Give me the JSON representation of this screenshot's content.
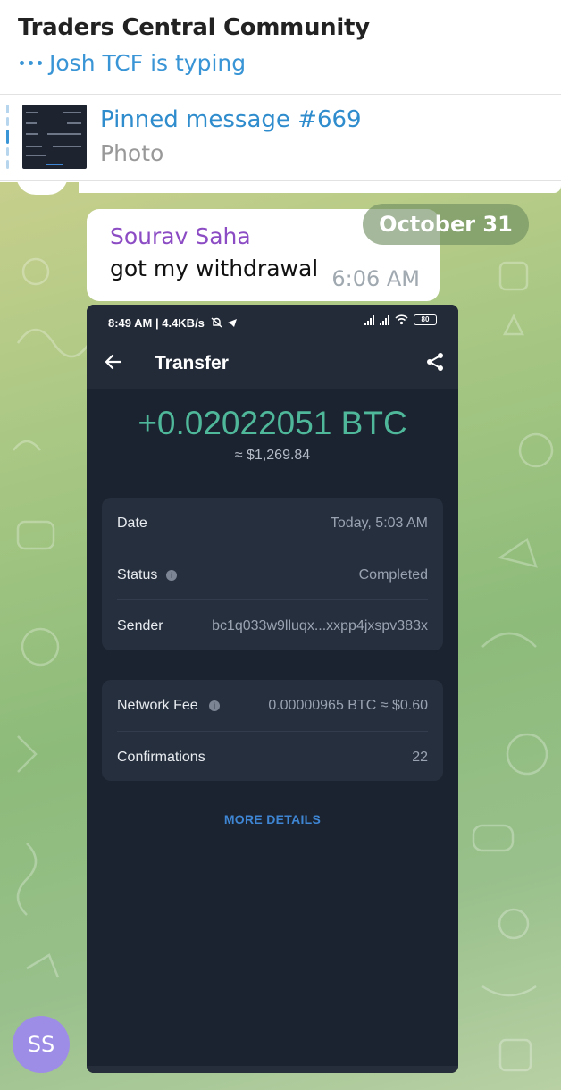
{
  "header": {
    "title": "Traders Central Community",
    "typing_text": "Josh TCF is typing"
  },
  "pinned": {
    "title": "Pinned message #669",
    "subtitle": "Photo"
  },
  "chat": {
    "date_chip": "October 31",
    "message": {
      "sender": "Sourav Saha",
      "text": "got my withdrawal",
      "time": "6:06 AM",
      "sender_color": "#8c4cc4"
    },
    "avatar_initials": "SS",
    "avatar_color": "#9e8de6"
  },
  "photo": {
    "status_bar": {
      "time": "8:49 AM | 4.4KB/s",
      "battery": "80"
    },
    "app_title": "Transfer",
    "amount": "+0.02022051 BTC",
    "fiat": "≈ $1,269.84",
    "details": [
      {
        "label": "Date",
        "value": "Today, 5:03 AM"
      },
      {
        "label": "Status",
        "value": "Completed"
      },
      {
        "label": "Sender",
        "value": "bc1q033w9lluqx...xxpp4jxspv383x"
      }
    ],
    "fees": [
      {
        "label": "Network Fee",
        "value": "0.00000965 BTC ≈ $0.60"
      },
      {
        "label": "Confirmations",
        "value": "22"
      }
    ],
    "more_details": "MORE DETAILS",
    "amount_color": "#4fb89a",
    "link_color": "#3e86d4"
  },
  "colors": {
    "accent": "#3a95d6"
  }
}
